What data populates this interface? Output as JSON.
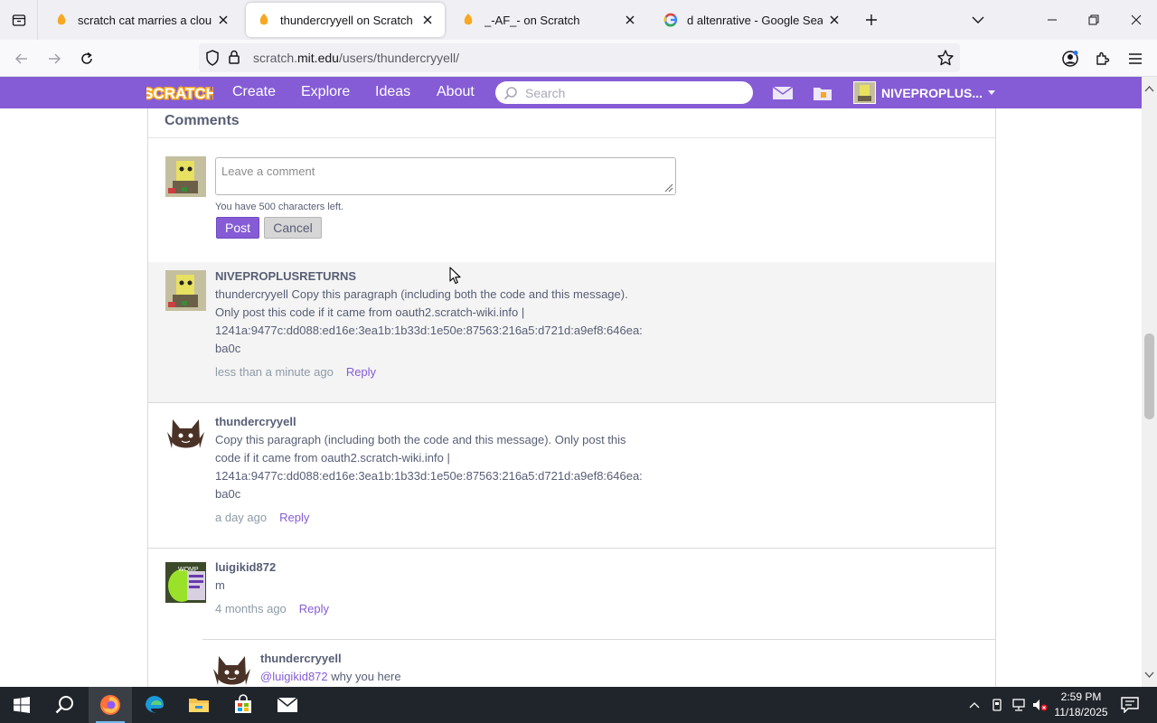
{
  "browser": {
    "tabs": [
      {
        "title": "scratch cat marries a cloud on S",
        "active": false
      },
      {
        "title": "thundercryyell on Scratch",
        "active": true
      },
      {
        "title": "_-AF_- on Scratch",
        "active": false
      },
      {
        "title": "d altenrative - Google Search",
        "active": false
      }
    ],
    "url_prefix": "scratch.",
    "url_domain": "mit.edu",
    "url_path": "/users/thundercryyell/"
  },
  "scratch_nav": {
    "logo": "SCRATCH",
    "links": [
      "Create",
      "Explore",
      "Ideas",
      "About"
    ],
    "search_placeholder": "Search",
    "username": "NIVEPROPLUS..."
  },
  "comments_section": {
    "title": "Comments",
    "compose_placeholder": "Leave a comment",
    "chars_left": "You have 500 characters left.",
    "post_label": "Post",
    "cancel_label": "Cancel",
    "comments": [
      {
        "user": "NIVEPROPLUSRETURNS",
        "lines": [
          "thundercryyell Copy this paragraph (including both the code and this message).",
          "Only post this code if it came from oauth2.scratch-wiki.info |",
          "1241a:9477c:dd088:ed16e:3ea1b:1b33d:1e50e:87563:216a5:d721d:a9ef8:646ea:",
          "ba0c"
        ],
        "time": "less than a minute ago",
        "reply": "Reply"
      },
      {
        "user": "thundercryyell",
        "lines": [
          "Copy this paragraph (including both the code and this message). Only post this",
          "code if it came from oauth2.scratch-wiki.info |",
          "1241a:9477c:dd088:ed16e:3ea1b:1b33d:1e50e:87563:216a5:d721d:a9ef8:646ea:",
          "ba0c"
        ],
        "time": "a day ago",
        "reply": "Reply"
      },
      {
        "user": "luigikid872",
        "lines": [
          "m"
        ],
        "time": "4 months ago",
        "reply": "Reply"
      },
      {
        "user": "thundercryyell",
        "mention": "@luigikid872",
        "text": " why you here"
      }
    ]
  },
  "taskbar": {
    "time": "2:59 PM",
    "date": "11/18/2025"
  },
  "colors": {
    "scratch_purple": "#855cd6",
    "text": "#575e75",
    "taskbar": "#20252b"
  }
}
